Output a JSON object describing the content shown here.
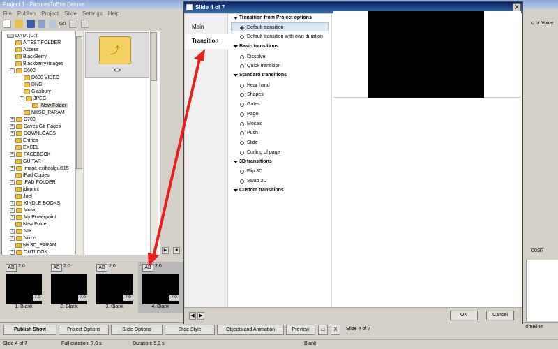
{
  "main": {
    "title": "Project 1 - PicturesToExe Deluxe",
    "menu": [
      "File",
      "Publish",
      "Project",
      "Slide",
      "Settings",
      "Help"
    ],
    "toolbar_drive": "G:\\",
    "right_label": "o or Voice",
    "right_time": "00:37",
    "timeline_label": "Timeline"
  },
  "tree": {
    "root": "DATA (G:)",
    "items": [
      {
        "label": "A TEST FOLDER"
      },
      {
        "label": "Access"
      },
      {
        "label": "BlackBerry"
      },
      {
        "label": "Blackberry images"
      },
      {
        "label": "D600"
      },
      {
        "label": "D600 VIDEO"
      },
      {
        "label": "DNG"
      },
      {
        "label": "Glasbury"
      },
      {
        "label": "JPEG"
      },
      {
        "label": "New Folder"
      },
      {
        "label": "NKSC_PARAM"
      },
      {
        "label": "D700"
      },
      {
        "label": "Daves Gtr Pages"
      },
      {
        "label": "DOWNLOADS"
      },
      {
        "label": "Entries"
      },
      {
        "label": "EXCEL"
      },
      {
        "label": "FACEBOOK"
      },
      {
        "label": "GUITAR"
      },
      {
        "label": "image-exiftoolgui515"
      },
      {
        "label": "iPad Copies"
      },
      {
        "label": "iPAD FOLDER"
      },
      {
        "label": "jdirprint"
      },
      {
        "label": "Joel"
      },
      {
        "label": "KINDLE BOOKS"
      },
      {
        "label": "Music"
      },
      {
        "label": "My Powerpoint"
      },
      {
        "label": "New Folder"
      },
      {
        "label": "NIK"
      },
      {
        "label": "Nikon"
      },
      {
        "label": "NKSC_PARAM"
      },
      {
        "label": "OUTLOOK"
      }
    ],
    "tile_label": "<..>"
  },
  "slides": [
    {
      "ab": "AB",
      "duration": "2.0",
      "transition": "7.0",
      "label": "1. Blank"
    },
    {
      "ab": "AB",
      "duration": "2.0",
      "transition": "7.0",
      "label": "2. Blank"
    },
    {
      "ab": "AB",
      "duration": "2.0",
      "transition": "7.0",
      "label": "3. Blank"
    },
    {
      "ab": "AB",
      "duration": "2.0",
      "transition": "7.0",
      "label": "4. Blank"
    }
  ],
  "bottom_buttons": {
    "publish": "Publish Show",
    "project_options": "Project Options",
    "slide_options": "Slide Options",
    "slide_style": "Slide Style",
    "objects": "Objects and Animation",
    "preview": "Preview",
    "x": "X",
    "slide_counter": "Slide 4 of 7"
  },
  "status": {
    "slide": "Slide 4 of 7",
    "full_duration": "Full duration: 7.0 s",
    "duration": "Duration: 5.0 s",
    "name": "Blank"
  },
  "dialog": {
    "title": "Slide 4 of 7",
    "close": "X",
    "tabs": {
      "main": "Main",
      "transition": "Transition"
    },
    "groups": {
      "project": "Transition from Project options",
      "basic": "Basic transitions",
      "standard": "Standard transitions",
      "three_d": "3D transitions",
      "custom": "Custom transitions"
    },
    "options": {
      "default_transition": "Default transition",
      "default_own": "Default transition with own duration",
      "dissolve": "Dissolve",
      "quick": "Quick transition",
      "hand": "Hear hand",
      "shapes": "Shapes",
      "gates": "Gates",
      "page": "Page",
      "mosaic": "Mosaic",
      "push": "Push",
      "slide": "Slide",
      "curling": "Curling of page",
      "flip": "Flip 3D",
      "swap": "Swap 3D"
    },
    "selected_option": "default_transition",
    "ok": "OK",
    "cancel": "Cancel",
    "nav_prev": "◀",
    "nav_next": "▶"
  },
  "colors": {
    "arrow": "#e82020",
    "dialog_title": "#0a246a",
    "selection": "#dbe6f4"
  }
}
